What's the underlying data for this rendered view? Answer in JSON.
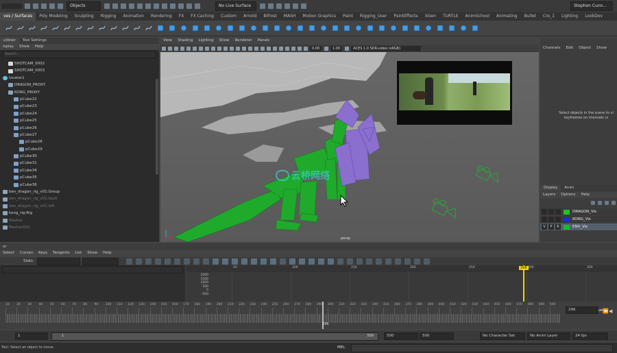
{
  "status_line": {
    "object_mode": "Objects",
    "live_surface": "No Live Surface",
    "user": "Stephen Cunn..."
  },
  "shelf_tabs": [
    "ves / Surfaces",
    "Poly Modeling",
    "Sculpting",
    "Rigging",
    "Animation",
    "Rendering",
    "FX",
    "FX Caching",
    "Custom",
    "Arnold",
    "Bifrost",
    "MASH",
    "Motion Graphics",
    "Paint",
    "Rigging_User",
    "PaintEffects",
    "XGen",
    "TURTLE",
    "AnimSchool",
    "Animating",
    "Bullet",
    "Cre_1",
    "Lighting",
    "LookDev"
  ],
  "shelf_active": "ves / Surfaces",
  "shelf_icon_names": [
    "nurbs-circle-icon",
    "curve-tool-icon",
    "curve-tool-icon",
    "curve-tool-icon",
    "curve-tool-icon",
    "curve-tool-icon",
    "curve-tool-icon",
    "curve-tool-icon",
    "curve-tool-icon",
    "curve-tool-icon",
    "curve-tool-icon",
    "curve-tool-icon",
    "curve-tool-icon",
    "nurbs-sphere-icon",
    "nurbs-cube-icon",
    "nurbs-cylinder-icon",
    "nurbs-cone-icon",
    "nurbs-plane-icon",
    "nurbs-torus-icon",
    "revolve-icon",
    "loft-icon",
    "planar-icon",
    "extrude-icon",
    "birail-icon",
    "boundary-icon",
    "square-icon",
    "bevel-icon",
    "intersect-icon",
    "project-curve-icon",
    "trim-icon",
    "untrim-icon",
    "attach-icon",
    "detach-icon",
    "align-icon",
    "open-close-icon",
    "insert-isoparm-icon",
    "extend-icon",
    "offset-icon",
    "rebuild-icon",
    "reverse-icon",
    "sculpt-icon"
  ],
  "outliner": {
    "tabs": [
      "utliner",
      "Tool Settings"
    ],
    "menu": [
      "isplay",
      "Show",
      "Help"
    ],
    "search_placeholder": "Search...",
    "items": [
      {
        "label": "SHOTCAM_0002",
        "indent": 1,
        "icon": "camera-icon",
        "dim": false
      },
      {
        "label": "SHOTCAM_0003",
        "indent": 1,
        "icon": "camera-icon",
        "dim": false
      },
      {
        "label": "locator1",
        "indent": 0,
        "icon": "locator-icon",
        "dim": false
      },
      {
        "label": "DRAGON_PROXY",
        "indent": 1,
        "icon": "group-icon",
        "dim": false
      },
      {
        "label": "KONG_PROXY",
        "indent": 1,
        "icon": "group-icon",
        "dim": false
      },
      {
        "label": "pCube22",
        "indent": 2,
        "icon": "mesh-icon",
        "dim": false
      },
      {
        "label": "pCube23",
        "indent": 2,
        "icon": "mesh-icon",
        "dim": false
      },
      {
        "label": "pCube24",
        "indent": 2,
        "icon": "mesh-icon",
        "dim": false
      },
      {
        "label": "pCube25",
        "indent": 2,
        "icon": "mesh-icon",
        "dim": false
      },
      {
        "label": "pCube26",
        "indent": 2,
        "icon": "mesh-icon",
        "dim": false
      },
      {
        "label": "pCube27",
        "indent": 2,
        "icon": "mesh-icon",
        "dim": false
      },
      {
        "label": "pCube28",
        "indent": 3,
        "icon": "mesh-icon",
        "dim": false
      },
      {
        "label": "pCube29",
        "indent": 3,
        "icon": "mesh-icon",
        "dim": false
      },
      {
        "label": "pCube30",
        "indent": 2,
        "icon": "mesh-icon",
        "dim": false
      },
      {
        "label": "pCube31",
        "indent": 2,
        "icon": "mesh-icon",
        "dim": false
      },
      {
        "label": "pCube34",
        "indent": 2,
        "icon": "mesh-icon",
        "dim": false
      },
      {
        "label": "pCube35",
        "indent": 2,
        "icon": "mesh-icon",
        "dim": false
      },
      {
        "label": "pCube36",
        "indent": 2,
        "icon": "mesh-icon",
        "dim": false
      },
      {
        "label": "ben_dragon_rig_v01:Group",
        "indent": 0,
        "icon": "group-icon",
        "dim": false
      },
      {
        "label": "ben_dragon_rig_v01:back",
        "indent": 0,
        "icon": "group-icon",
        "dim": true
      },
      {
        "label": "ben_dragon_rig_v01:left",
        "indent": 0,
        "icon": "group-icon",
        "dim": true
      },
      {
        "label": "kong_rig:Rig",
        "indent": 0,
        "icon": "group-icon",
        "dim": false
      },
      {
        "label": "Mesher",
        "indent": 0,
        "icon": "group-icon",
        "dim": true
      },
      {
        "label": "Mesher002",
        "indent": 0,
        "icon": "group-icon",
        "dim": true
      }
    ]
  },
  "viewport": {
    "menu": [
      "View",
      "Shading",
      "Lighting",
      "Show",
      "Renderer",
      "Panels"
    ],
    "exposure": "0.00",
    "gamma": "1.00",
    "color_space": "ACES 1.0 SDR-video (sRGB)",
    "camera_label": "persp",
    "watermark": "云桥网络"
  },
  "channel_box": {
    "menu": [
      "Channels",
      "Edit",
      "Object",
      "Show"
    ],
    "hint": "Select objects in the scene to vi keyframes on channels (s",
    "tabs": [
      "Display",
      "Anim"
    ],
    "layer_menu": [
      "Layers",
      "Options",
      "Help"
    ],
    "layers": [
      {
        "name": "DRAGON_Vis",
        "color": "#22c22a",
        "v": "",
        "p": "",
        "r": ""
      },
      {
        "name": "KONG_Vis",
        "color": "#1b2bd8",
        "v": "",
        "p": "",
        "r": ""
      },
      {
        "name": "ENV_Vis",
        "color": "#19b832",
        "v": "V",
        "p": "P",
        "r": "R"
      }
    ]
  },
  "graph_editor": {
    "title": "or",
    "menu": [
      "Select",
      "Curves",
      "Keys",
      "Tangents",
      "List",
      "Show",
      "Help"
    ],
    "stats_label": "Stats",
    "value_ticks": [
      "2000",
      "1500",
      "1000",
      "500",
      "0",
      "-500"
    ],
    "frame_ticks": [
      "50",
      "100",
      "150",
      "200",
      "250",
      "300",
      "350"
    ],
    "current_frame": "296"
  },
  "time_slider": {
    "ticks": [
      "10",
      "20",
      "30",
      "40",
      "50",
      "60",
      "70",
      "80",
      "90",
      "100",
      "110",
      "120",
      "130",
      "140",
      "150",
      "160",
      "170",
      "180",
      "190",
      "200",
      "210",
      "220",
      "230",
      "240",
      "250",
      "260",
      "270",
      "280",
      "290",
      "300",
      "310",
      "320",
      "330",
      "340",
      "350",
      "360",
      "370",
      "380",
      "390",
      "400",
      "410",
      "420",
      "430",
      "440",
      "450",
      "460",
      "470",
      "480",
      "490",
      "500"
    ],
    "current_label": "296",
    "current_frame_field": "296"
  },
  "range_slider": {
    "start": "1",
    "range_start": "1",
    "range_end": "500",
    "end": "500",
    "anim_end": "500",
    "character_set": "No Character Set",
    "anim_layer": "No Anim Layer",
    "fps": "24 fps"
  },
  "command_line": {
    "lang": "MEL",
    "help": "Tool: Select an object to move."
  },
  "colors": {
    "dragon": "#1faa2c",
    "kong": "#8a6fcf",
    "timeline_marker": "#f2d600"
  }
}
